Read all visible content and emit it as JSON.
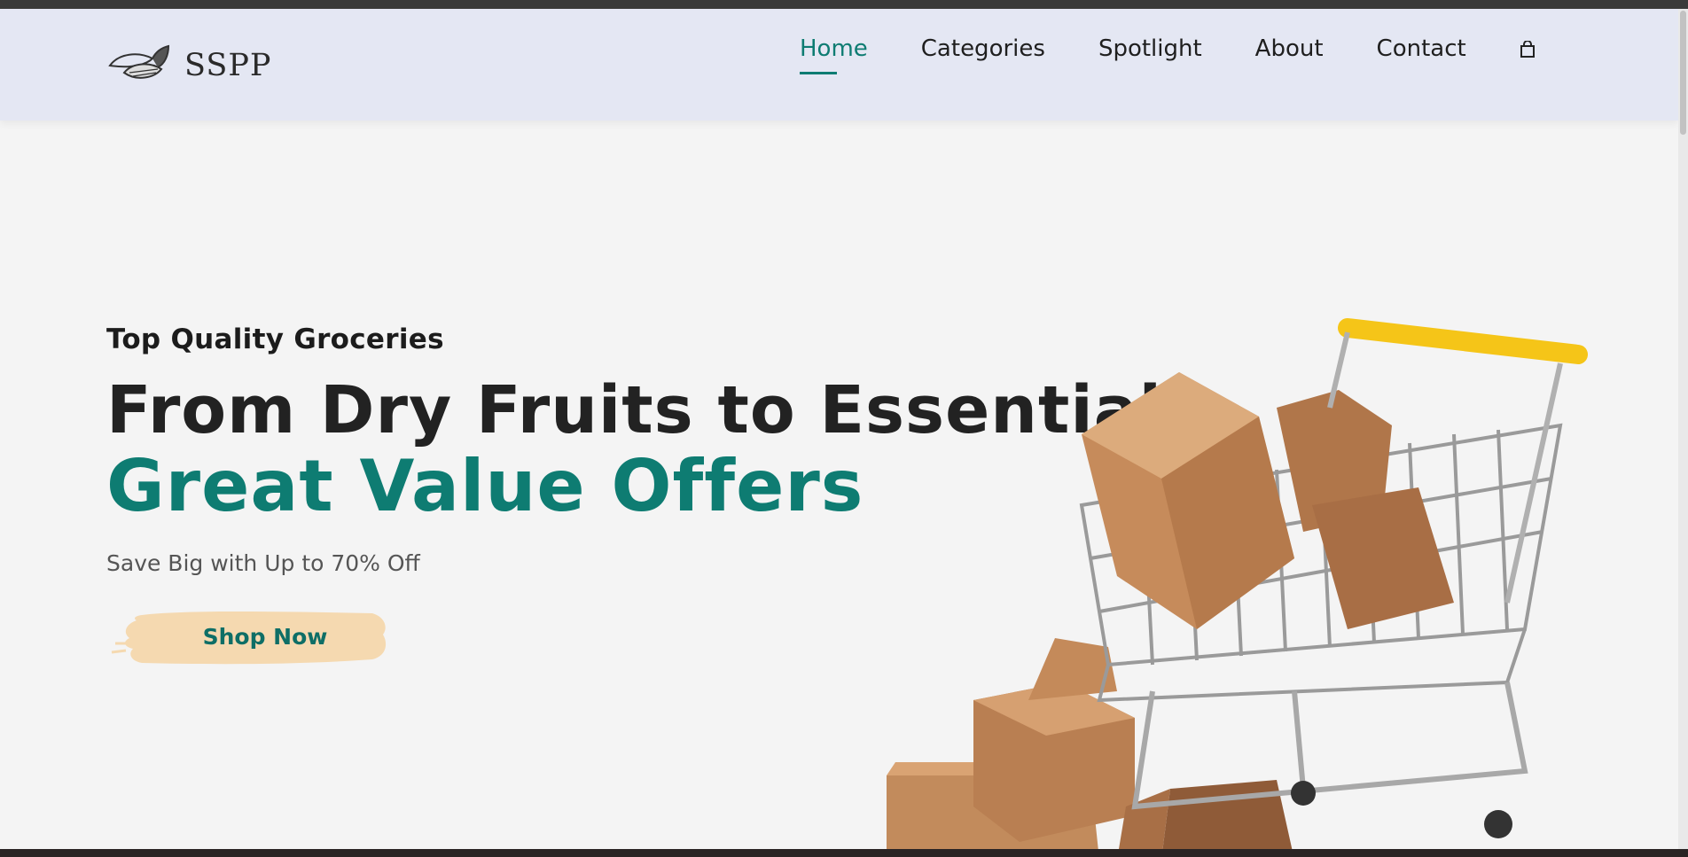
{
  "brand": {
    "name": "SSPP",
    "logo_icon": "almond-logo-icon"
  },
  "nav": {
    "items": [
      {
        "label": "Home",
        "active": true
      },
      {
        "label": "Categories",
        "active": false
      },
      {
        "label": "Spotlight",
        "active": false
      },
      {
        "label": "About",
        "active": false
      },
      {
        "label": "Contact",
        "active": false
      }
    ],
    "cart_icon": "shopping-bag-icon"
  },
  "hero": {
    "eyebrow": "Top Quality Groceries",
    "headline_line1": "From Dry Fruits to Essentials",
    "headline_line2": "Great Value Offers",
    "subtext": "Save Big with Up to 70% Off",
    "cta_label": "Shop Now",
    "image": "shopping-cart-with-boxes-illustration"
  },
  "colors": {
    "accent": "#0e7c72",
    "header_bg": "#e4e7f3",
    "cta_bg": "#f5d9b0",
    "page_bg": "#f4f4f4"
  }
}
